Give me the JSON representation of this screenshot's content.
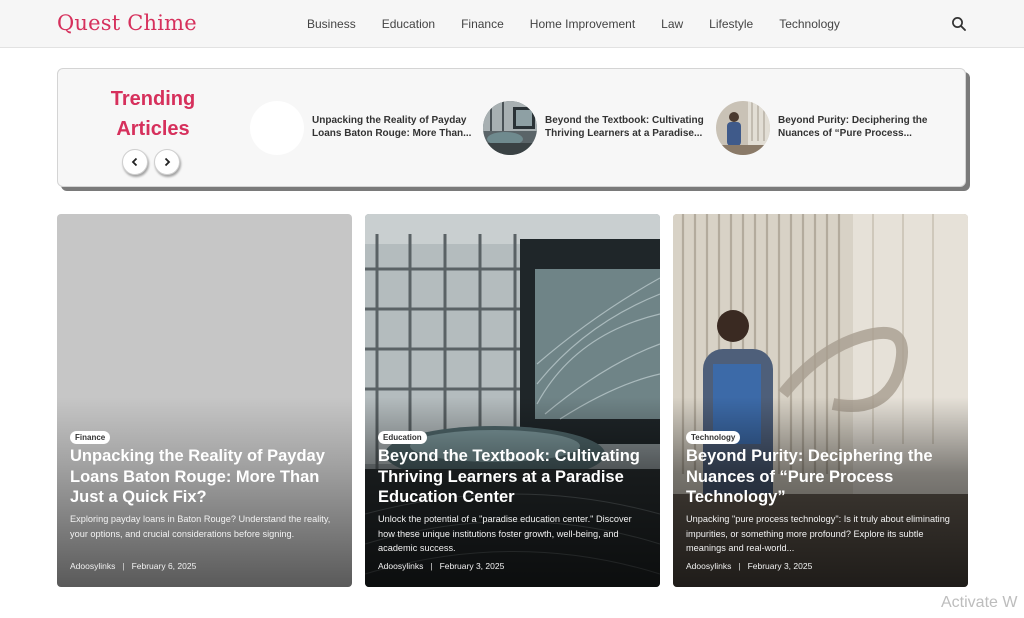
{
  "site": {
    "logo": "Quest Chime"
  },
  "nav": [
    "Business",
    "Education",
    "Finance",
    "Home Improvement",
    "Law",
    "Lifestyle",
    "Technology"
  ],
  "trending": {
    "title_line1": "Trending",
    "title_line2": "Articles",
    "items": [
      {
        "title_line1": "Unpacking the Reality of Payday",
        "title_line2": "Loans Baton Rouge: More Than..."
      },
      {
        "title_line1": "Beyond the Textbook: Cultivating",
        "title_line2": "Thriving Learners at a Paradise..."
      },
      {
        "title_line1": "Beyond Purity: Deciphering the",
        "title_line2": "Nuances of “Pure Process..."
      }
    ]
  },
  "cards": [
    {
      "category": "Finance",
      "title": "Unpacking the Reality of Payday Loans Baton Rouge: More Than Just a Quick Fix?",
      "excerpt": "Exploring payday loans in Baton Rouge? Understand the reality, your options, and crucial considerations before signing.",
      "author": "Adoosylinks",
      "date": "February 6, 2025"
    },
    {
      "category": "Education",
      "title": "Beyond the Textbook: Cultivating Thriving Learners at a Paradise Education Center",
      "excerpt": "Unlock the potential of a \"paradise education center.\" Discover how these unique institutions foster growth, well-being, and academic success.",
      "author": "Adoosylinks",
      "date": "February 3, 2025"
    },
    {
      "category": "Technology",
      "title": "Beyond Purity: Deciphering the Nuances of “Pure Process Technology”",
      "excerpt": "Unpacking \"pure process technology\": Is it truly about eliminating impurities, or something more profound? Explore its subtle meanings and real-world...",
      "author": "Adoosylinks",
      "date": "February 3, 2025"
    }
  ],
  "overlay": {
    "activate_text": "Activate W"
  },
  "colors": {
    "brand": "#d6305c",
    "header_bg": "#f6f6f6"
  },
  "icons": {
    "search": "search-icon",
    "prev": "chevron-left-icon",
    "next": "chevron-right-icon"
  }
}
